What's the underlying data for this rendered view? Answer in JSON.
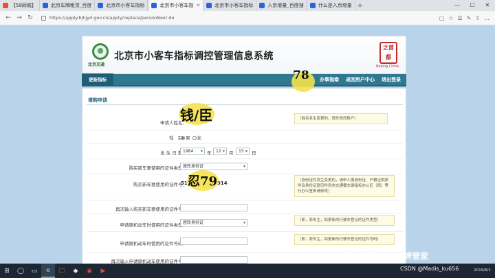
{
  "browser": {
    "tabs": [
      {
        "label": "【58同城】",
        "color": "#e8512b",
        "active": false
      },
      {
        "label": "北京车牌租赁_百度",
        "color": "#2c63d9",
        "active": false
      },
      {
        "label": "北京市小客车指标",
        "color": "#2c63d9",
        "active": false
      },
      {
        "label": "北京市小客车指",
        "color": "#2c63d9",
        "active": true
      },
      {
        "label": "北京市小客车指标",
        "color": "#2c63d9",
        "active": false
      },
      {
        "label": "入京增量_百度搜",
        "color": "#2c63d9",
        "active": false
      },
      {
        "label": "什么是入京增量",
        "color": "#2c63d9",
        "active": false
      }
    ],
    "new_tab": "+",
    "window_controls": [
      "—",
      "☐",
      "✕"
    ],
    "url": "https://apply.bjhjyd.gov.cn/apply/replace/personNext.do",
    "nav": {
      "back": "←",
      "forward": "→",
      "refresh": "↻"
    },
    "tools": [
      "▢",
      "☆",
      "☰",
      "✎",
      "⇪",
      "…"
    ]
  },
  "site": {
    "logo_caption": "北京交通",
    "title": "北京市小客车指标调控管理信息系统",
    "seal_text": "之首都",
    "seal_caption": "Beijing China"
  },
  "navbar": {
    "current": "更新指标",
    "links": [
      "办事指南",
      "返回用户中心",
      "退出登录"
    ]
  },
  "form": {
    "section": "增购申请",
    "applicant_label": "申请人姓名：",
    "applicant_hint": "（姓名发生变更的，请先修改账户）",
    "gender_label": "性　别：",
    "gender_male": "男",
    "gender_female": "女",
    "dob_label": "出 生 日 期：",
    "dob_year": "1984",
    "dob_year_unit": "年",
    "dob_month": "12",
    "dob_month_unit": "月",
    "dob_day": "15",
    "dob_day_unit": "日",
    "id_type_label": "购买新车要使用的证件类型：",
    "id_type_value": "居民身份证",
    "id_number_label": "购买新车要使用的证件号：",
    "id_number_prefix": "510",
    "id_number_suffix": "914",
    "id_hint": "（身份证件发生变更的，请申人携身份证、户籍证明原件及身份证复印件到市交通委车辆指标办公区（西）等行办公室申请修改）",
    "id_confirm_label": "再次输入购买新车要使用的证件号：",
    "old_car_type_label": "申请原机动车时使用的证件类型：",
    "old_car_type_value": "居民身份证",
    "old_car_type_hint": "（即，原车主，拟更新的行驶车登记的证件类型）",
    "old_car_number_label": "申请原机动车时使用的证件号码：",
    "old_car_number_hint": "（即，原车主，拟更新的行驶车登记的证件号码）",
    "old_car_confirm_label": "再次输入申请原机动车使用的证件号："
  },
  "handwriting": {
    "name": "钱/臣",
    "id_middle": "忍79",
    "corner": "78"
  },
  "taskbar": {
    "icons": [
      "⊞",
      "◯",
      "▭",
      "e",
      "🗀",
      "◆",
      "◉",
      "▶"
    ],
    "clock_time": "",
    "clock_date": "2019/6/1"
  },
  "watermarks": {
    "zhihu": "知乎 @万鑫车务京牌管家",
    "csdn": "CSDN @Madis_ku656"
  }
}
